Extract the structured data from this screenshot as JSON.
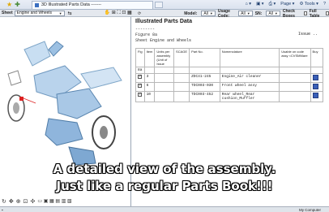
{
  "browser": {
    "tab_title": "3D Illustrated Parts Data -------",
    "cmd_page": "Page",
    "cmd_tools": "Tools"
  },
  "toolbar": {
    "sheet_label": "Sheet",
    "sheet_value": "Engine and Wheels",
    "model_label": "Model:",
    "model_value": "All",
    "usage_label": "Usage Code:",
    "usage_value": "All",
    "sn_label": "SN:",
    "sn_value": "All",
    "check_boxes_label": "Check Boxes",
    "full_table_label": "Full Table"
  },
  "panel": {
    "title": "Illustrated Parts Data",
    "dashes": "--------",
    "figure": "Figure 8a",
    "sheet": "Sheet Engine and Wheels",
    "issue": "Issue ..",
    "columns": [
      "Fig",
      "Item",
      "Units per assembly (Unit of Issue",
      "SCAGE",
      "Part No.",
      "Nomenclature",
      "Usable on code assy <CVSMMare",
      "Buy"
    ],
    "fig_value": "8a",
    "rows": [
      {
        "item": "3",
        "part_no": "ZDC41-245",
        "nomenclature": "Engine_Air cleaner"
      },
      {
        "item": "6",
        "part_no": "TDC003-030",
        "nomenclature": "Front wheel assy"
      },
      {
        "item": "10",
        "part_no": "TDC003-452",
        "nomenclature": "Rear wheel_Rear cushion_Muffler"
      }
    ]
  },
  "status": {
    "right": "My Computer"
  },
  "caption": {
    "line1": "A detailed view of the assembly.",
    "line2": "Just like a regular Parts Book!!!"
  }
}
